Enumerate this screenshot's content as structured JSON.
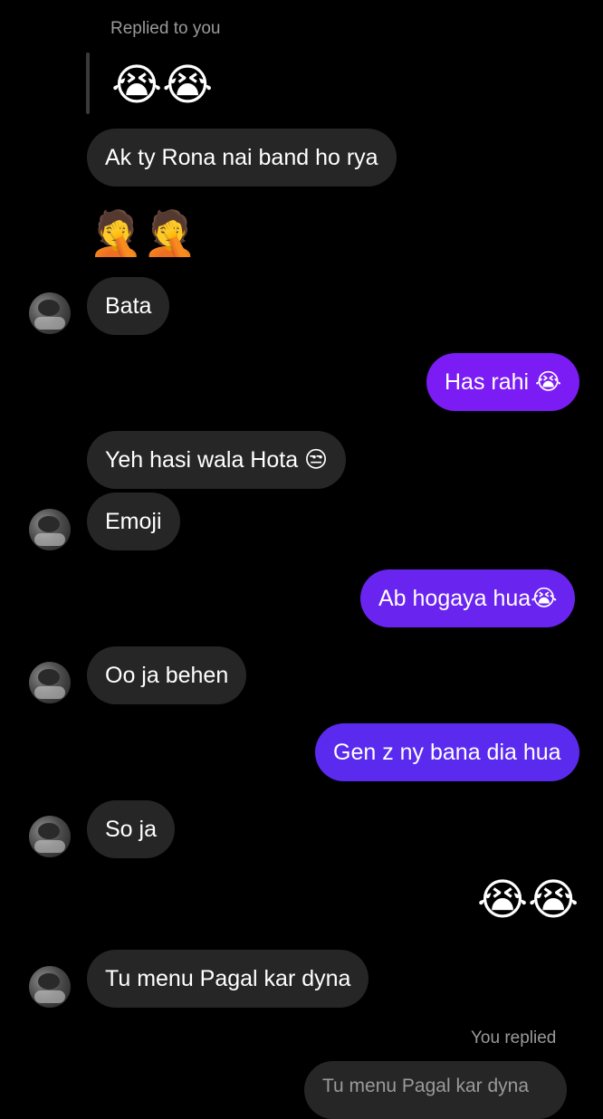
{
  "reply_top": {
    "label": "Replied to you",
    "quoted_emoji": "😭😭"
  },
  "messages": [
    {
      "side": "in",
      "text": "Ak ty Rona nai band ho rya"
    },
    {
      "side": "in",
      "text": "🤦🤦",
      "kind": "emoji"
    },
    {
      "side": "in",
      "text": "Bata",
      "avatar": "avatar-icon"
    },
    {
      "side": "out",
      "text": "Has rahi 😭"
    },
    {
      "side": "in",
      "text": "Yeh hasi  wala Hota 😒"
    },
    {
      "side": "in",
      "text": "Emoji",
      "avatar": "avatar-icon"
    },
    {
      "side": "out",
      "text": "Ab hogaya hua😭"
    },
    {
      "side": "in",
      "text": "Oo ja behen",
      "avatar": "avatar-icon"
    },
    {
      "side": "out",
      "text": "Gen z ny bana dia hua"
    },
    {
      "side": "in",
      "text": "So ja",
      "avatar": "avatar-icon"
    },
    {
      "side": "out",
      "text": "😭😭",
      "kind": "emoji"
    },
    {
      "side": "in",
      "text": "Tu menu Pagal kar dyna",
      "avatar": "avatar-icon"
    }
  ],
  "reply_bottom": {
    "label": "You replied",
    "quoted_text": "Tu menu Pagal kar dyna"
  },
  "colors": {
    "background": "#000000",
    "incoming_bubble": "#262626",
    "outgoing_bubble": "#7b1cf4",
    "meta_text": "#9a9a9a"
  }
}
